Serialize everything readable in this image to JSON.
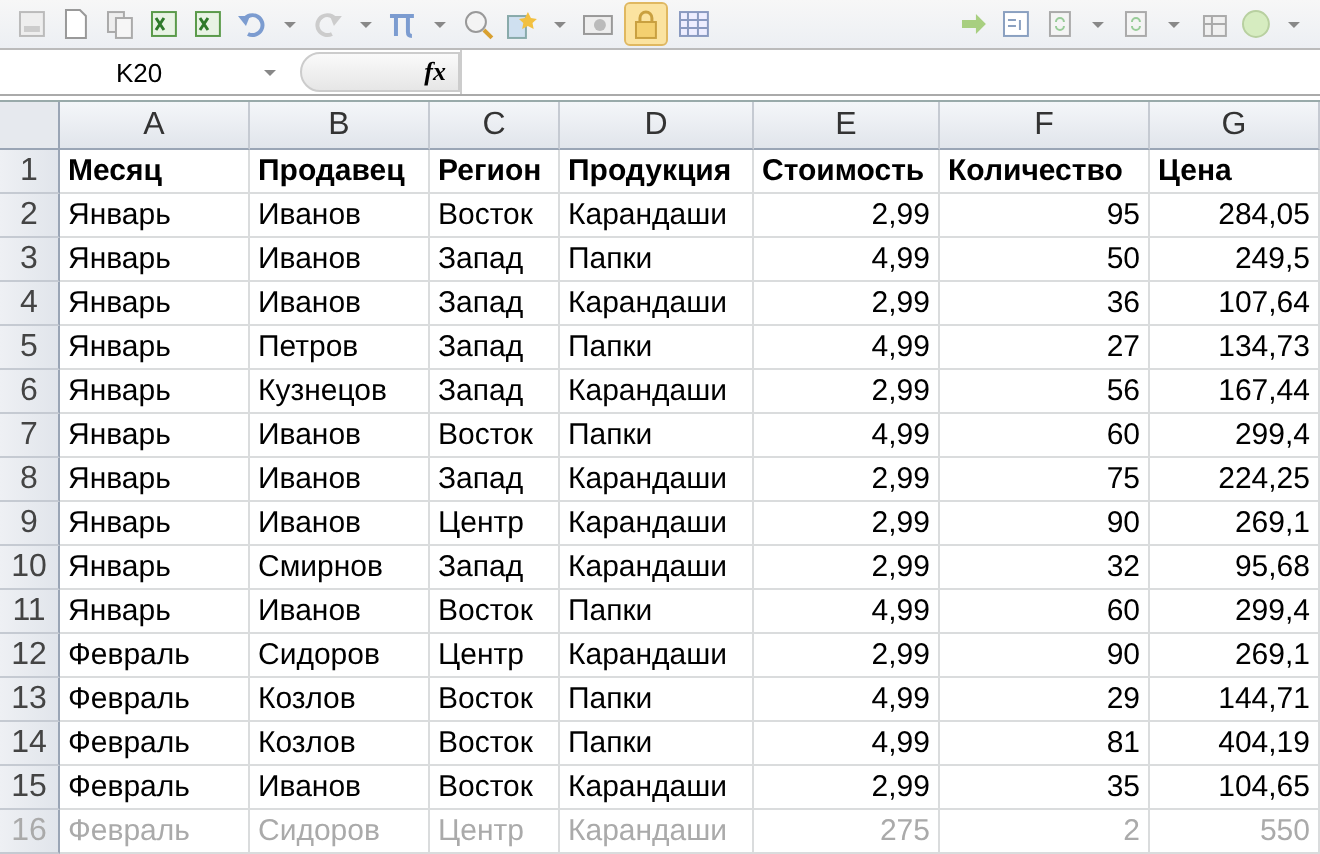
{
  "formula_bar": {
    "name_box": "K20",
    "function_label": "fx"
  },
  "columns": [
    "A",
    "B",
    "C",
    "D",
    "E",
    "F",
    "G"
  ],
  "rows": [
    {
      "number": "1",
      "header": true,
      "cells": [
        "Месяц",
        "Продавец",
        "Регион",
        "Продукция",
        "Стоимость",
        "Количество",
        "Цена"
      ]
    },
    {
      "number": "2",
      "header": false,
      "cells": [
        "Январь",
        "Иванов",
        "Восток",
        "Карандаши",
        "2,99",
        "95",
        "284,05"
      ]
    },
    {
      "number": "3",
      "header": false,
      "cells": [
        "Январь",
        "Иванов",
        "Запад",
        "Папки",
        "4,99",
        "50",
        "249,5"
      ]
    },
    {
      "number": "4",
      "header": false,
      "cells": [
        "Январь",
        "Иванов",
        "Запад",
        "Карандаши",
        "2,99",
        "36",
        "107,64"
      ]
    },
    {
      "number": "5",
      "header": false,
      "cells": [
        "Январь",
        "Петров",
        "Запад",
        "Папки",
        "4,99",
        "27",
        "134,73"
      ]
    },
    {
      "number": "6",
      "header": false,
      "cells": [
        "Январь",
        "Кузнецов",
        "Запад",
        "Карандаши",
        "2,99",
        "56",
        "167,44"
      ]
    },
    {
      "number": "7",
      "header": false,
      "cells": [
        "Январь",
        "Иванов",
        "Восток",
        "Папки",
        "4,99",
        "60",
        "299,4"
      ]
    },
    {
      "number": "8",
      "header": false,
      "cells": [
        "Январь",
        "Иванов",
        "Запад",
        "Карандаши",
        "2,99",
        "75",
        "224,25"
      ]
    },
    {
      "number": "9",
      "header": false,
      "cells": [
        "Январь",
        "Иванов",
        "Центр",
        "Карандаши",
        "2,99",
        "90",
        "269,1"
      ]
    },
    {
      "number": "10",
      "header": false,
      "cells": [
        "Январь",
        "Смирнов",
        "Запад",
        "Карандаши",
        "2,99",
        "32",
        "95,68"
      ]
    },
    {
      "number": "11",
      "header": false,
      "cells": [
        "Январь",
        "Иванов",
        "Восток",
        "Папки",
        "4,99",
        "60",
        "299,4"
      ]
    },
    {
      "number": "12",
      "header": false,
      "cells": [
        "Февраль",
        "Сидоров",
        "Центр",
        "Карандаши",
        "2,99",
        "90",
        "269,1"
      ]
    },
    {
      "number": "13",
      "header": false,
      "cells": [
        "Февраль",
        "Козлов",
        "Восток",
        "Папки",
        "4,99",
        "29",
        "144,71"
      ]
    },
    {
      "number": "14",
      "header": false,
      "cells": [
        "Февраль",
        "Козлов",
        "Восток",
        "Папки",
        "4,99",
        "81",
        "404,19"
      ]
    },
    {
      "number": "15",
      "header": false,
      "cells": [
        "Февраль",
        "Иванов",
        "Восток",
        "Карандаши",
        "2,99",
        "35",
        "104,65"
      ]
    },
    {
      "number": "16",
      "header": false,
      "cells": [
        "Февраль",
        "Сидоров",
        "Центр",
        "Карандаши",
        "275",
        "2",
        "550"
      ]
    }
  ]
}
